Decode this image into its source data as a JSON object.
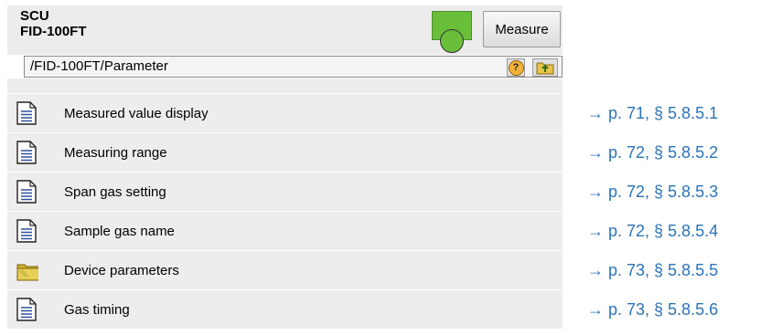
{
  "header": {
    "line1": "SCU",
    "line2": "FID-100FT",
    "measure_label": "Measure",
    "status_color": "#6abf3a"
  },
  "path": "/FID-100FT/Parameter",
  "toolbar": {
    "help_icon": "help-icon",
    "up_icon": "folder-up-icon"
  },
  "menu": [
    {
      "label": "Measured value display",
      "icon": "document-icon",
      "ref": "→ p. 71, § 5.8.5.1"
    },
    {
      "label": "Measuring range",
      "icon": "document-icon",
      "ref": "→ p. 72, § 5.8.5.2"
    },
    {
      "label": "Span gas setting",
      "icon": "document-icon",
      "ref": "→ p. 72, § 5.8.5.3"
    },
    {
      "label": "Sample gas name",
      "icon": "document-icon",
      "ref": "→ p. 72, § 5.8.5.4"
    },
    {
      "label": "Device parameters",
      "icon": "folder-icon",
      "ref": "→ p. 73, § 5.8.5.5"
    },
    {
      "label": "Gas timing",
      "icon": "document-icon",
      "ref": "→ p. 73, § 5.8.5.6"
    }
  ]
}
